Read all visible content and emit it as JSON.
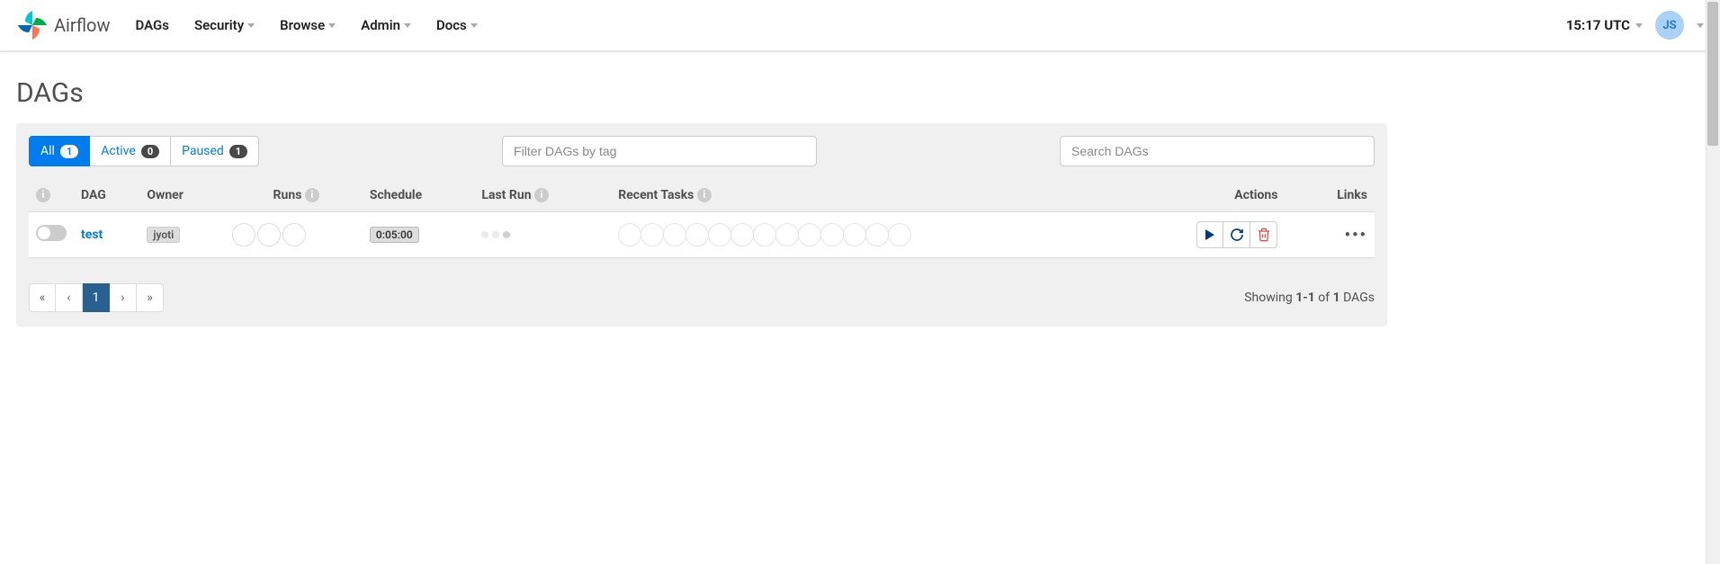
{
  "brand": {
    "name": "Airflow"
  },
  "nav": {
    "dags": "DAGs",
    "security": "Security",
    "browse": "Browse",
    "admin": "Admin",
    "docs": "Docs"
  },
  "clock": "15:17 UTC",
  "user_initials": "JS",
  "page_title": "DAGs",
  "filters": {
    "all_label": "All",
    "all_count": "1",
    "active_label": "Active",
    "active_count": "0",
    "paused_label": "Paused",
    "paused_count": "1",
    "tag_placeholder": "Filter DAGs by tag",
    "search_placeholder": "Search DAGs"
  },
  "headers": {
    "dag": "DAG",
    "owner": "Owner",
    "runs": "Runs",
    "schedule": "Schedule",
    "last_run": "Last Run",
    "recent_tasks": "Recent Tasks",
    "actions": "Actions",
    "links": "Links"
  },
  "row": {
    "dag_name": "test",
    "owner": "jyoti",
    "schedule": "0:05:00"
  },
  "runs_count": 3,
  "tasks_count": 13,
  "pagination": {
    "first": "«",
    "prev": "‹",
    "current": "1",
    "next": "›",
    "last": "»",
    "showing_prefix": "Showing ",
    "range": "1-1",
    "of": " of ",
    "total": "1",
    "suffix": " DAGs"
  }
}
